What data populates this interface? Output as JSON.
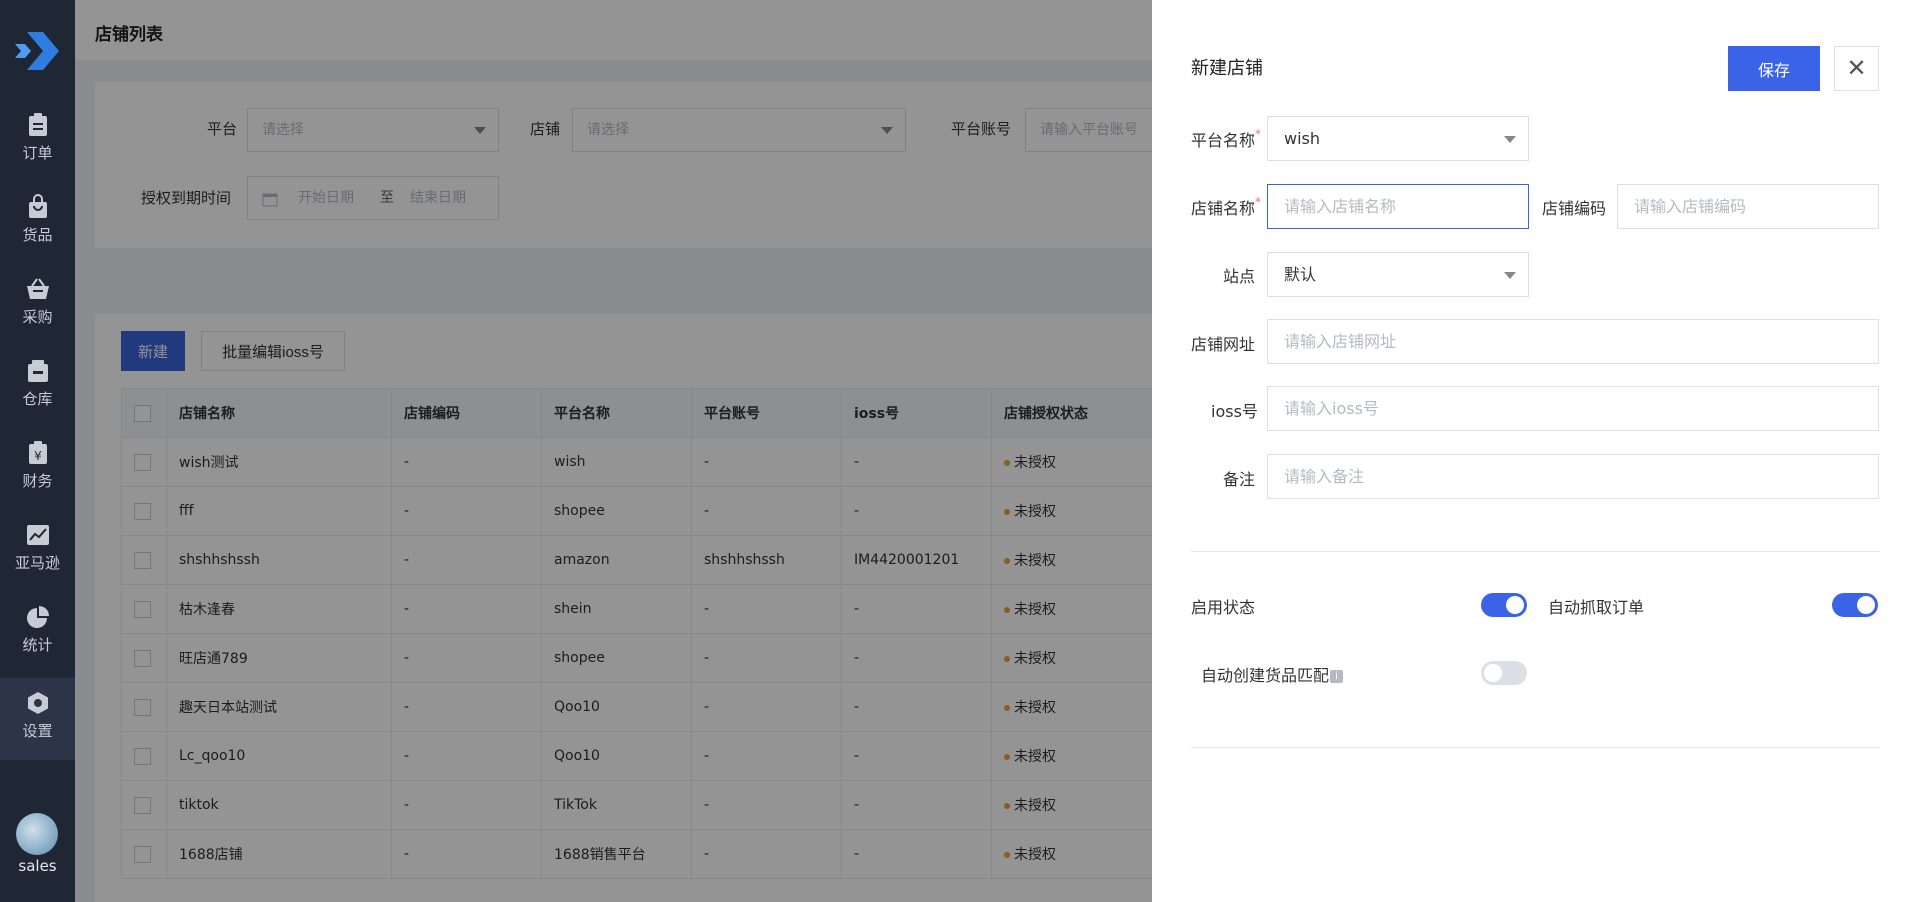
{
  "sidebar": {
    "items": [
      {
        "label": "订单",
        "icon": "clipboard-icon"
      },
      {
        "label": "货品",
        "icon": "bag-icon"
      },
      {
        "label": "采购",
        "icon": "basket-icon"
      },
      {
        "label": "仓库",
        "icon": "warehouse-icon"
      },
      {
        "label": "财务",
        "icon": "yen-icon"
      },
      {
        "label": "亚马逊",
        "icon": "chart-icon"
      },
      {
        "label": "统计",
        "icon": "pie-icon"
      },
      {
        "label": "设置",
        "icon": "settings-icon"
      }
    ],
    "active": "设置",
    "user": "sales"
  },
  "page": {
    "title": "店铺列表"
  },
  "filters": {
    "platform_label": "平台",
    "platform_placeholder": "请选择",
    "shop_label": "店铺",
    "shop_placeholder": "请选择",
    "account_label": "平台账号",
    "account_placeholder": "请输入平台账号",
    "auth_expiry_label": "授权到期时间",
    "start_date_placeholder": "开始日期",
    "date_sep": "至",
    "end_date_placeholder": "结束日期"
  },
  "toolbar": {
    "new_label": "新建",
    "batch_label": "批量编辑ioss号"
  },
  "table": {
    "columns": [
      "店铺名称",
      "店铺编码",
      "平台名称",
      "平台账号",
      "ioss号",
      "店铺授权状态"
    ],
    "rows": [
      [
        "wish测试",
        "-",
        "wish",
        "-",
        "-",
        "未授权"
      ],
      [
        "fff",
        "-",
        "shopee",
        "-",
        "-",
        "未授权"
      ],
      [
        "shshhshssh",
        "-",
        "amazon",
        "shshhshssh",
        "IM4420001201",
        "未授权"
      ],
      [
        "枯木逢春",
        "-",
        "shein",
        "-",
        "-",
        "未授权"
      ],
      [
        "旺店通789",
        "-",
        "shopee",
        "-",
        "-",
        "未授权"
      ],
      [
        "趣天日本站测试",
        "-",
        "Qoo10",
        "-",
        "-",
        "未授权"
      ],
      [
        "Lc_qoo10",
        "-",
        "Qoo10",
        "-",
        "-",
        "未授权"
      ],
      [
        "tiktok",
        "-",
        "TikTok",
        "-",
        "-",
        "未授权"
      ],
      [
        "1688店铺",
        "-",
        "1688销售平台",
        "-",
        "-",
        "未授权"
      ]
    ],
    "status_color": "#e6a23c"
  },
  "drawer": {
    "title": "新建店铺",
    "save_label": "保存",
    "close_symbol": "✕",
    "platform_name_label": "平台名称",
    "platform_name_value": "wish",
    "shop_name_label": "店铺名称",
    "shop_name_placeholder": "请输入店铺名称",
    "shop_code_label": "店铺编码",
    "shop_code_placeholder": "请输入店铺编码",
    "site_label": "站点",
    "site_value": "默认",
    "shop_url_label": "店铺网址",
    "shop_url_placeholder": "请输入店铺网址",
    "ioss_label": "ioss号",
    "ioss_placeholder": "请输入ioss号",
    "remark_label": "备注",
    "remark_placeholder": "请输入备注",
    "enable_label": "启用状态",
    "enable_on": true,
    "auto_fetch_label": "自动抓取订单",
    "auto_fetch_on": true,
    "auto_match_label": "自动创建货品匹配",
    "auto_match_on": false,
    "required_mark": "*",
    "accent_color": "#3b63e8"
  }
}
